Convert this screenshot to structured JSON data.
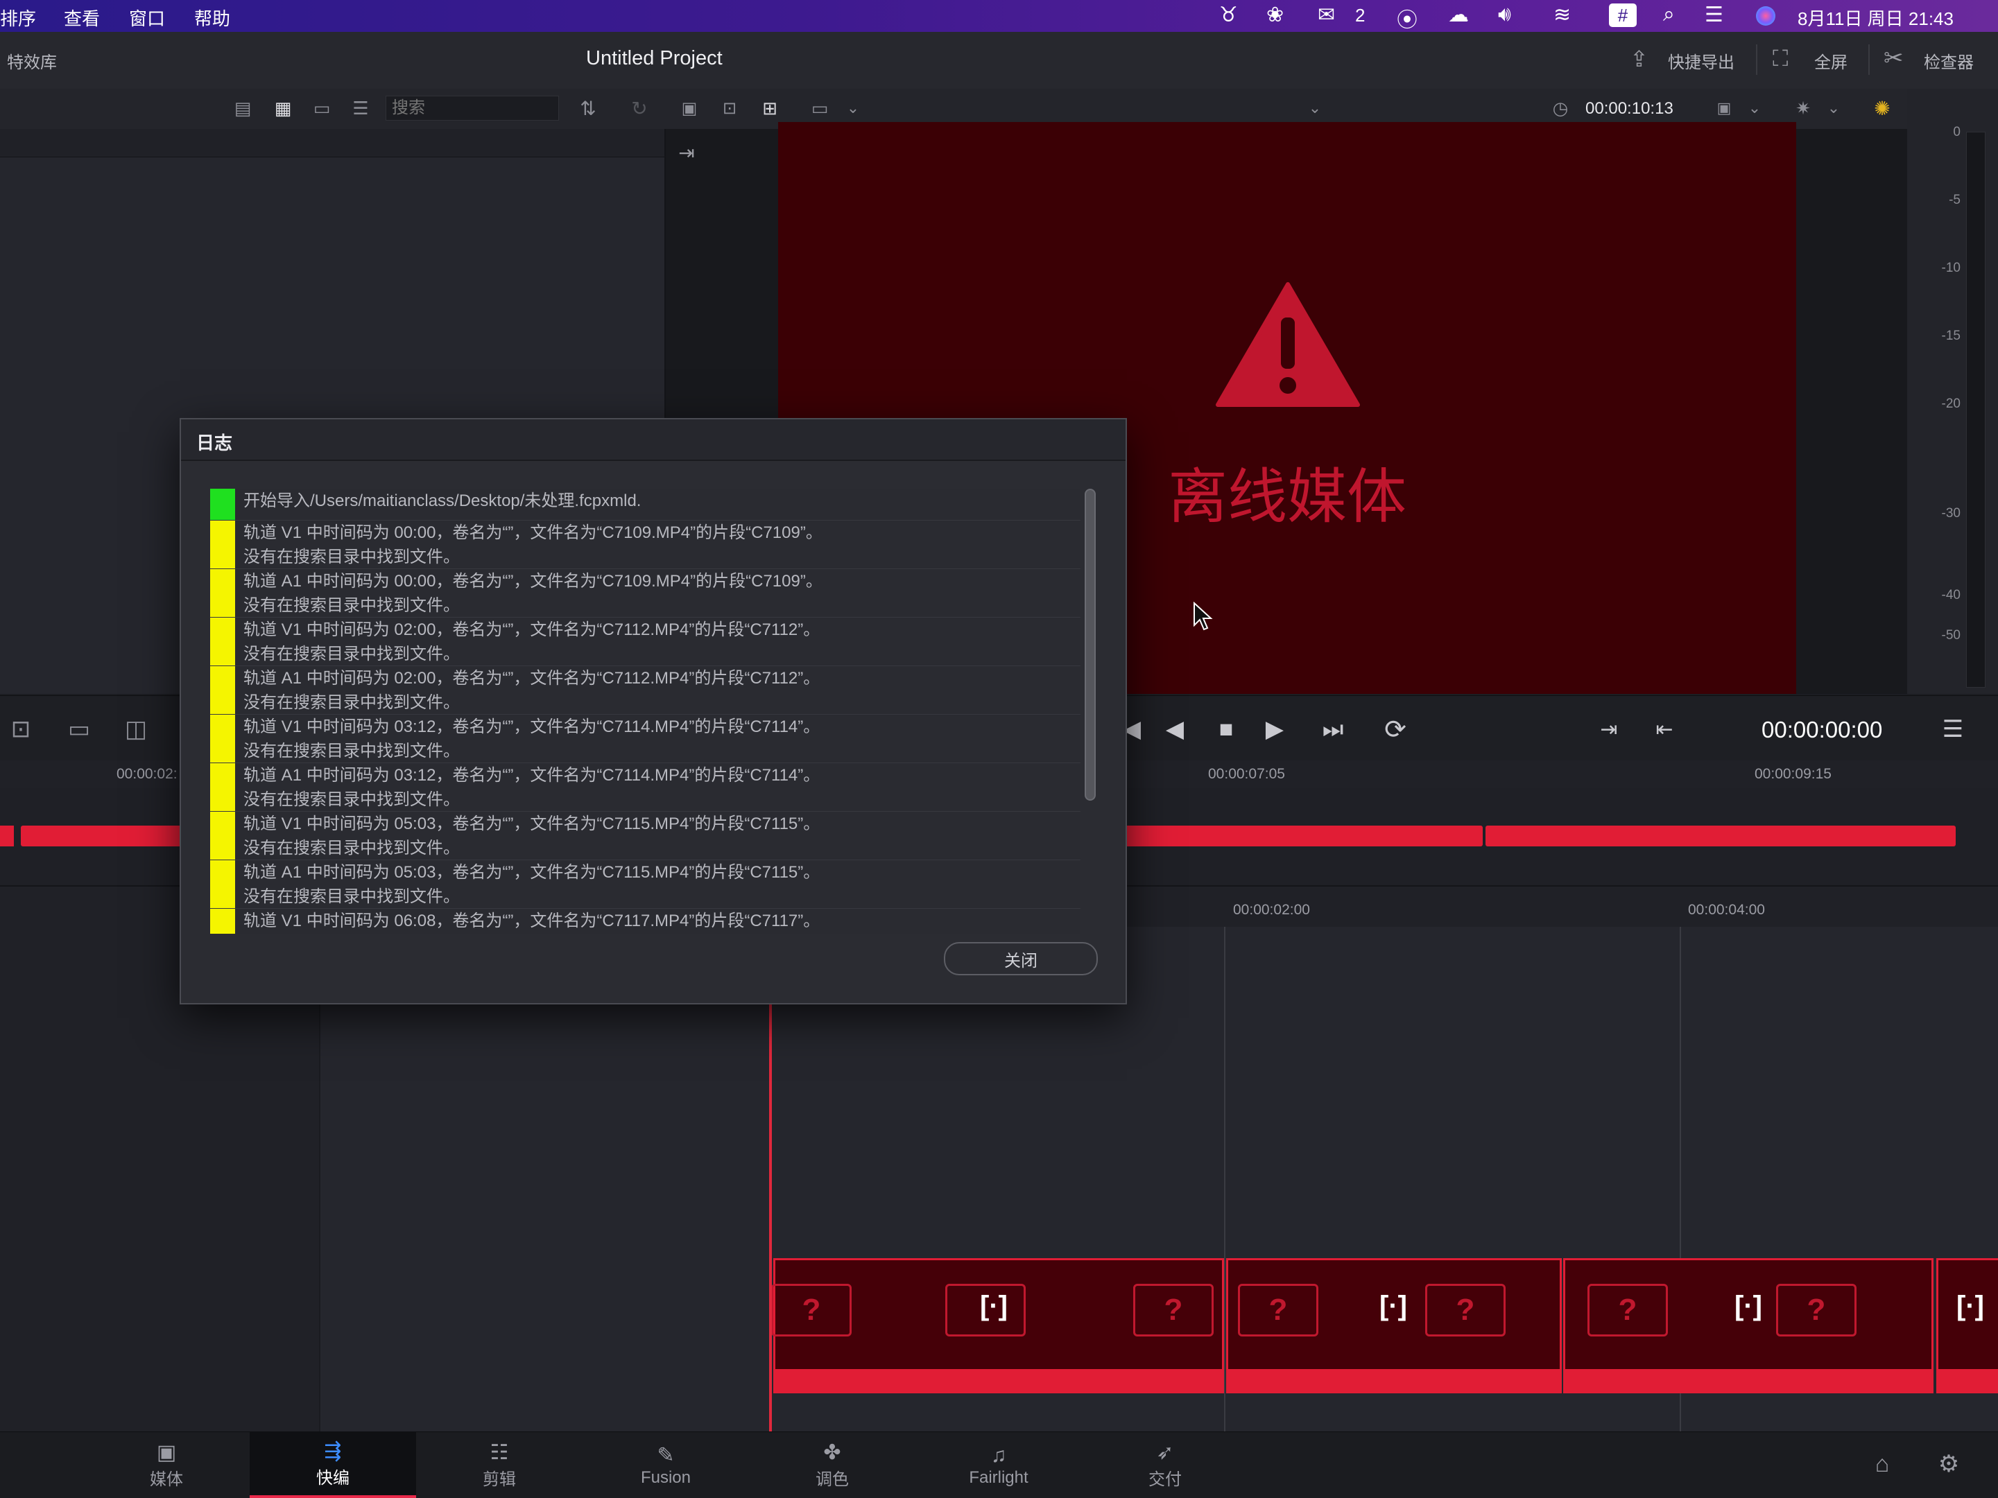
{
  "menubar": {
    "items": [
      "排序",
      "查看",
      "窗口",
      "帮助"
    ],
    "wechat_badge": "2",
    "datetime": "8月11日 周日 21:43"
  },
  "project": {
    "left_label": "特效库",
    "title": "Untitled Project",
    "quick_export": "快捷导出",
    "fullscreen": "全屏",
    "inspector": "检查器"
  },
  "toolbar": {
    "search_placeholder": "搜索",
    "timecode": "00:00:10:13"
  },
  "viewer": {
    "offline_text": "离线媒体"
  },
  "meter": {
    "labels": [
      "0",
      "-5",
      "-10",
      "-15",
      "-20",
      "-30",
      "-40",
      "-50"
    ]
  },
  "transport": {
    "timecode": "00:00:00:00"
  },
  "ruler1": {
    "ticks": [
      "00:00:02:",
      "00:00:07:05",
      "00:00:09:15"
    ]
  },
  "ruler2": {
    "ticks": [
      "00:00:02:00",
      "00:00:04:00"
    ]
  },
  "dialog": {
    "title": "日志",
    "close_label": "关闭",
    "entries": [
      {
        "status": "ok",
        "color": "#1fe01f",
        "lines": [
          "开始导入/Users/maitianclass/Desktop/未处理.fcpxmld."
        ]
      },
      {
        "status": "warn",
        "color": "#f5f500",
        "lines": [
          "轨道 V1 中时间码为 00:00，卷名为“”，文件名为“C7109.MP4”的片段“C7109”。",
          "没有在搜索目录中找到文件。"
        ]
      },
      {
        "status": "warn",
        "color": "#f5f500",
        "lines": [
          "轨道 A1 中时间码为 00:00，卷名为“”，文件名为“C7109.MP4”的片段“C7109”。",
          "没有在搜索目录中找到文件。"
        ]
      },
      {
        "status": "warn",
        "color": "#f5f500",
        "lines": [
          "轨道 V1 中时间码为 02:00，卷名为“”，文件名为“C7112.MP4”的片段“C7112”。",
          "没有在搜索目录中找到文件。"
        ]
      },
      {
        "status": "warn",
        "color": "#f5f500",
        "lines": [
          "轨道 A1 中时间码为 02:00，卷名为“”，文件名为“C7112.MP4”的片段“C7112”。",
          "没有在搜索目录中找到文件。"
        ]
      },
      {
        "status": "warn",
        "color": "#f5f500",
        "lines": [
          "轨道 V1 中时间码为 03:12，卷名为“”，文件名为“C7114.MP4”的片段“C7114”。",
          "没有在搜索目录中找到文件。"
        ]
      },
      {
        "status": "warn",
        "color": "#f5f500",
        "lines": [
          "轨道 A1 中时间码为 03:12，卷名为“”，文件名为“C7114.MP4”的片段“C7114”。",
          "没有在搜索目录中找到文件。"
        ]
      },
      {
        "status": "warn",
        "color": "#f5f500",
        "lines": [
          "轨道 V1 中时间码为 05:03，卷名为“”，文件名为“C7115.MP4”的片段“C7115”。",
          "没有在搜索目录中找到文件。"
        ]
      },
      {
        "status": "warn",
        "color": "#f5f500",
        "lines": [
          "轨道 A1 中时间码为 05:03，卷名为“”，文件名为“C7115.MP4”的片段“C7115”。",
          "没有在搜索目录中找到文件。"
        ]
      },
      {
        "status": "warn",
        "color": "#f5f500",
        "lines": [
          "轨道 V1 中时间码为 06:08，卷名为“”，文件名为“C7117.MP4”的片段“C7117”。"
        ]
      }
    ]
  },
  "bottomnav": {
    "tabs": [
      {
        "label": "媒体",
        "icon": "media-icon",
        "active": false
      },
      {
        "label": "快编",
        "icon": "cut-icon",
        "active": true
      },
      {
        "label": "剪辑",
        "icon": "edit-icon",
        "active": false
      },
      {
        "label": "Fusion",
        "icon": "fusion-icon",
        "active": false
      },
      {
        "label": "调色",
        "icon": "color-icon",
        "active": false
      },
      {
        "label": "Fairlight",
        "icon": "fairlight-icon",
        "active": false
      },
      {
        "label": "交付",
        "icon": "deliver-icon",
        "active": false
      }
    ]
  },
  "colors": {
    "accent_red": "#e11d35",
    "offline_bg": "#3b0005",
    "playhead": "#e0283c"
  }
}
